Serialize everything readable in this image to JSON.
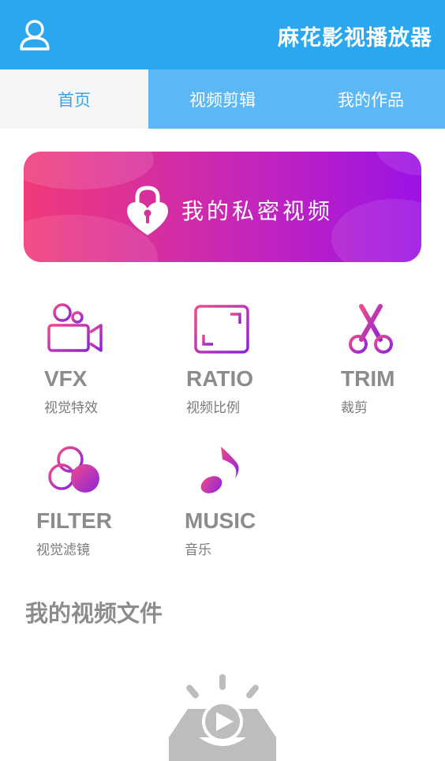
{
  "header": {
    "title": "麻花影视播放器",
    "user_icon": "user-icon",
    "bg_color": "#2aa7ee"
  },
  "tabs": [
    {
      "label": "首页",
      "active": true
    },
    {
      "label": "视频剪辑",
      "active": false
    },
    {
      "label": "我的作品",
      "active": false
    }
  ],
  "banner": {
    "label": "我的私密视频",
    "icon": "heart-lock-icon",
    "gradient": [
      "#f03a7a",
      "#9b12e6"
    ]
  },
  "tools": [
    {
      "en": "VFX",
      "zh": "视觉特效",
      "icon": "video-camera-icon"
    },
    {
      "en": "RATIO",
      "zh": "视频比例",
      "icon": "crop-frame-icon"
    },
    {
      "en": "TRIM",
      "zh": "裁剪",
      "icon": "scissors-icon"
    },
    {
      "en": "FILTER",
      "zh": "视觉滤镜",
      "icon": "color-filter-icon"
    },
    {
      "en": "MUSIC",
      "zh": "音乐",
      "icon": "music-note-icon"
    }
  ],
  "files": {
    "section_title": "我的视频文件",
    "empty_icon": "empty-video-tray-icon"
  }
}
